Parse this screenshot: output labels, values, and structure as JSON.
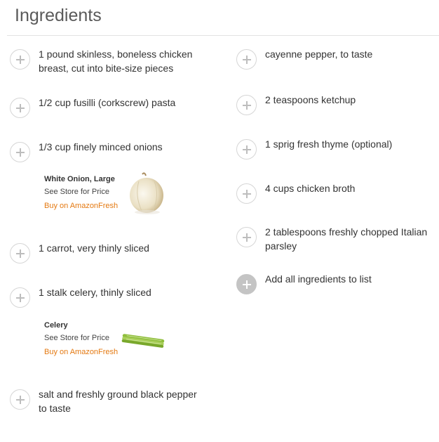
{
  "section": {
    "title": "Ingredients"
  },
  "left_column": [
    {
      "text": "1 pound skinless, boneless chicken breast, cut into bite-size pieces"
    },
    {
      "text": "1/2 cup fusilli (corkscrew) pasta"
    },
    {
      "text": "1/3 cup finely minced onions"
    },
    {
      "text": "1 carrot, very thinly sliced"
    },
    {
      "text": "1 stalk celery, thinly sliced"
    },
    {
      "text": "salt and freshly ground black pepper to taste"
    }
  ],
  "right_column": [
    {
      "text": "cayenne pepper, to taste"
    },
    {
      "text": "2 teaspoons ketchup"
    },
    {
      "text": "1 sprig fresh thyme (optional)"
    },
    {
      "text": "4 cups chicken broth"
    },
    {
      "text": "2 tablespoons freshly chopped Italian parsley"
    }
  ],
  "add_all": {
    "label": "Add all ingredients to list"
  },
  "products": [
    {
      "name": "White Onion, Large",
      "price": "See Store for Price",
      "buy": "Buy on AmazonFresh",
      "icon": "onion-image"
    },
    {
      "name": "Celery",
      "price": "See Store for Price",
      "buy": "Buy on AmazonFresh",
      "icon": "celery-image"
    }
  ],
  "colors": {
    "buy_link": "#e47911",
    "add_circle": "#c4c4c4"
  }
}
